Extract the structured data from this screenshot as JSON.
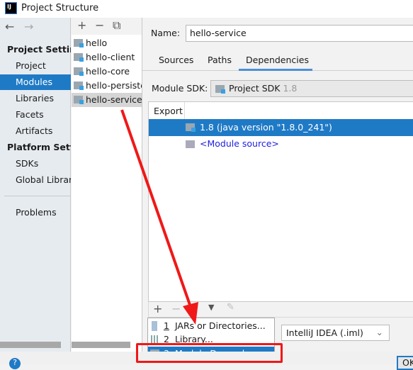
{
  "window": {
    "title": "Project Structure",
    "logo": "IJ"
  },
  "nav": {
    "back": "←",
    "forward": "→",
    "project_settings": "Project Settings",
    "items1": [
      "Project",
      "Modules",
      "Libraries",
      "Facets",
      "Artifacts"
    ],
    "platform_settings": "Platform Settings",
    "items2": [
      "SDKs",
      "Global Libraries"
    ],
    "problems": "Problems",
    "selected": "Modules"
  },
  "modules": {
    "toolbar": [
      "+",
      "−",
      "⧉"
    ],
    "items": [
      "hello",
      "hello-client",
      "hello-core",
      "hello-persistence",
      "hello-service"
    ],
    "selected": "hello-service"
  },
  "editor": {
    "name_label": "Name:",
    "name_value": "hello-service",
    "tabs": [
      "Sources",
      "Paths",
      "Dependencies"
    ],
    "active_tab": "Dependencies",
    "sdk_label": "Module SDK:",
    "sdk_value": "Project SDK",
    "sdk_version": "1.8",
    "export_header": "Export",
    "rows": [
      "1.8 (java version \"1.8.0_241\")",
      "<Module source>"
    ],
    "format_value": "IntelliJ IDEA (.iml)",
    "ok": "OK"
  },
  "popup": {
    "items": [
      {
        "num": "1",
        "label": "JARs or Directories..."
      },
      {
        "num": "2",
        "label": "Library..."
      },
      {
        "num": "3",
        "label": "Module Dependency..."
      }
    ]
  },
  "colors": {
    "selection": "#1f7ac6",
    "annotation": "#f01818",
    "link": "#2020e0"
  }
}
